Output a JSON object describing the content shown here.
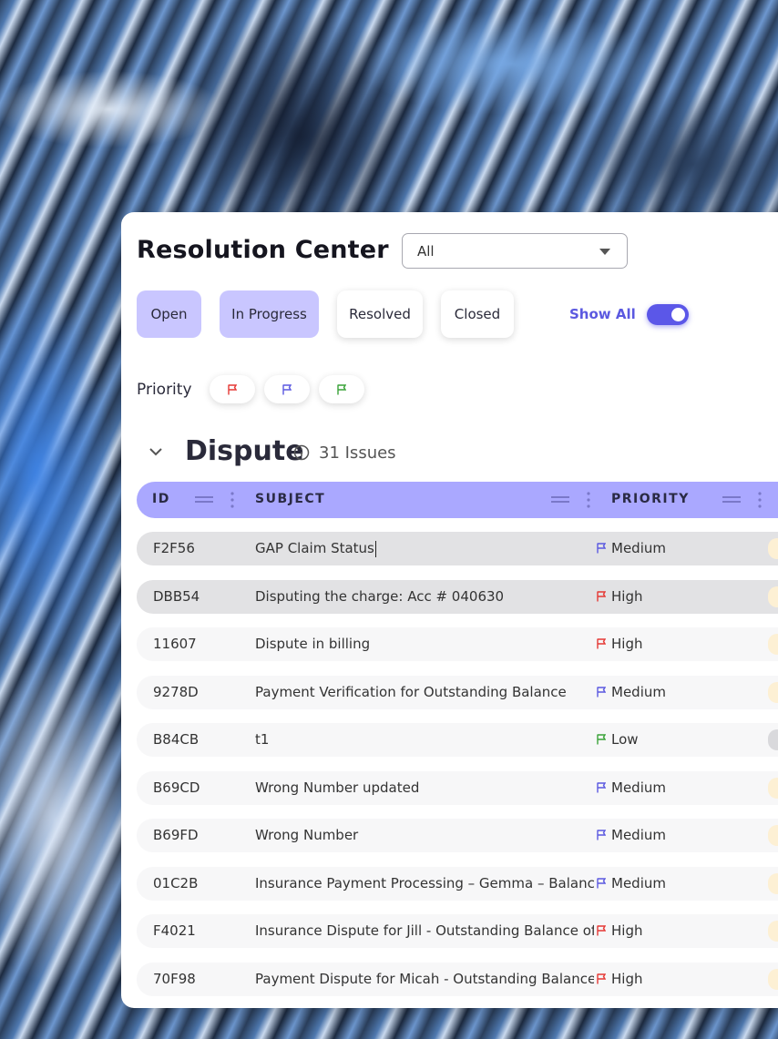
{
  "header": {
    "title": "Resolution Center",
    "filter_value": "All"
  },
  "status_chips": [
    {
      "label": "Open",
      "active": true
    },
    {
      "label": "In Progress",
      "active": true
    },
    {
      "label": "Resolved",
      "active": false
    },
    {
      "label": "Closed",
      "active": false
    }
  ],
  "show_all": {
    "label": "Show All",
    "enabled": true
  },
  "priority_filter": {
    "label": "Priority",
    "flags": [
      {
        "name": "high",
        "color": "#e53935"
      },
      {
        "name": "medium",
        "color": "#5b59e0"
      },
      {
        "name": "low",
        "color": "#3aa339"
      }
    ]
  },
  "section": {
    "title": "Dispute",
    "count_label": "31 Issues"
  },
  "table": {
    "columns": [
      "ID",
      "SUBJECT",
      "PRIORITY"
    ],
    "rows": [
      {
        "id": "F2F56",
        "subject": "GAP Claim Status",
        "priority": "Medium",
        "selected": true
      },
      {
        "id": "DBB54",
        "subject": "Disputing the charge: Acc # 040630",
        "priority": "High",
        "selected": true
      },
      {
        "id": "11607",
        "subject": "Dispute in billing",
        "priority": "High",
        "selected": false
      },
      {
        "id": "9278D",
        "subject": "Payment Verification for Outstanding Balance",
        "priority": "Medium",
        "selected": false
      },
      {
        "id": "B84CB",
        "subject": "t1",
        "priority": "Low",
        "selected": false
      },
      {
        "id": "B69CD",
        "subject": "Wrong Number updated",
        "priority": "Medium",
        "selected": false
      },
      {
        "id": "B69FD",
        "subject": "Wrong Number",
        "priority": "Medium",
        "selected": false
      },
      {
        "id": "01C2B",
        "subject": "Insurance Payment Processing – Gemma – Balance",
        "priority": "Medium",
        "selected": false
      },
      {
        "id": "F4021",
        "subject": "Insurance Dispute for Jill - Outstanding Balance of",
        "priority": "High",
        "selected": false
      },
      {
        "id": "70F98",
        "subject": "Payment Dispute for Micah - Outstanding Balance",
        "priority": "High",
        "selected": false
      }
    ]
  },
  "colors": {
    "accent": "#5b59e0",
    "chip_active": "#c9c6ff",
    "header_bg": "#aaa8ff",
    "high": "#e53935",
    "medium": "#5b59e0",
    "low": "#3aa339"
  }
}
